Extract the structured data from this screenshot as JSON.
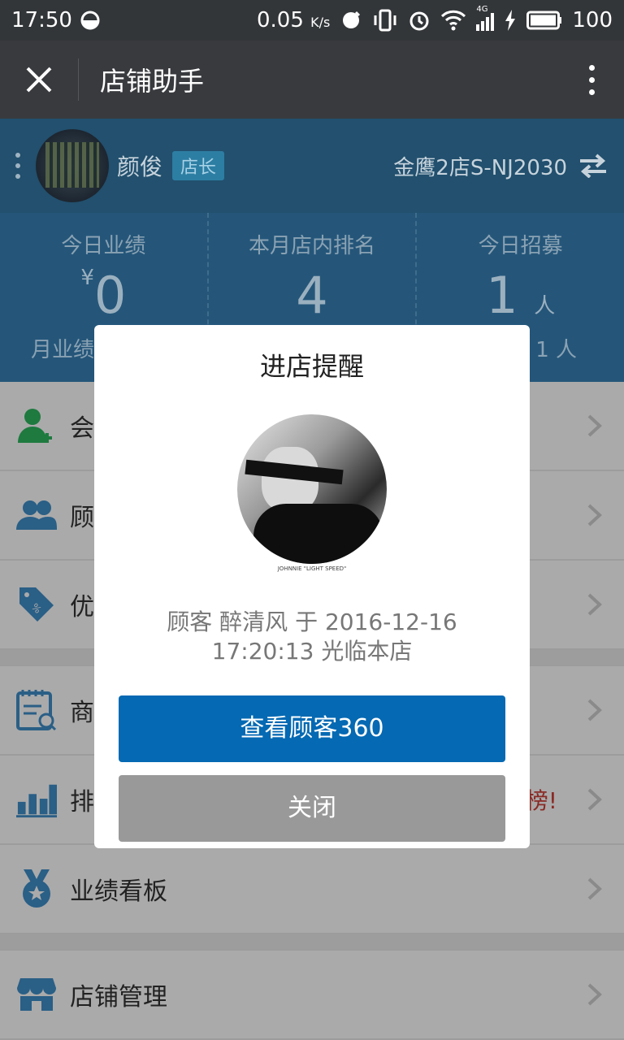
{
  "status_bar": {
    "time": "17:50",
    "net_speed": "0.05",
    "net_unit": "K/s",
    "network": "4G",
    "battery": "100"
  },
  "header": {
    "title": "店铺助手"
  },
  "profile": {
    "name": "颜俊",
    "role_badge": "店长",
    "store": "金鹰2店S-NJ2030"
  },
  "stats": [
    {
      "label": "今日业绩",
      "currency": "¥",
      "value": "0",
      "sub": "月业绩"
    },
    {
      "label": "本月店内排名",
      "value": "4"
    },
    {
      "label": "今日招募",
      "value": "1",
      "unit": "人",
      "sub": "1 人"
    }
  ],
  "menu": [
    {
      "label": "会",
      "icon": "add-member-icon"
    },
    {
      "label": "顾",
      "icon": "customers-icon"
    },
    {
      "label": "优",
      "icon": "coupon-tag-icon"
    },
    {
      "label": "商",
      "icon": "product-search-icon"
    },
    {
      "label": "排",
      "icon": "ranking-chart-icon",
      "note": "榜!"
    },
    {
      "label": "业绩看板",
      "icon": "medal-icon"
    },
    {
      "label": "店铺管理",
      "icon": "store-icon"
    }
  ],
  "dialog": {
    "title": "进店提醒",
    "avatar_caption": "JOHNNIE \"LIGHT SPEED\"",
    "message_line1": "顾客 醉清风 于 2016-12-16",
    "message_line2": "17:20:13 光临本店",
    "primary_button": "查看顾客360",
    "secondary_button": "关闭"
  },
  "colors": {
    "title_bar": "#393a3e",
    "profile_bg": "#22506e",
    "stats_bg": "#25567a",
    "primary_button": "#0569b3",
    "secondary_button": "#999999",
    "overlay_dim": "#aaaaaa"
  }
}
